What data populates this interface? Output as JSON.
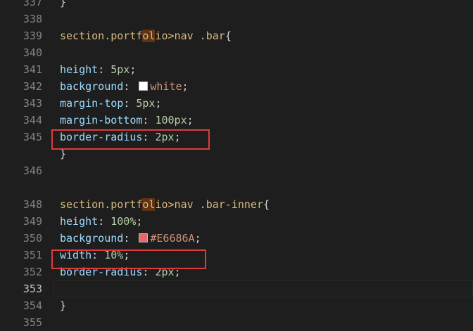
{
  "colors": {
    "swatch_white": "#ffffff",
    "swatch_bar_inner": "#E6686A",
    "highlight_box": "#e03b3b"
  },
  "lines": [
    {
      "num": "337",
      "parts": [
        {
          "t": "}",
          "c": "punc"
        }
      ]
    },
    {
      "num": "338",
      "parts": []
    },
    {
      "num": "339",
      "parts": [
        {
          "t": "section.portf",
          "c": "sel"
        },
        {
          "t": "ol",
          "c": "sel hl"
        },
        {
          "t": "io>nav .bar",
          "c": "sel"
        },
        {
          "t": "{",
          "c": "punc"
        }
      ]
    },
    {
      "num": "340",
      "parts": []
    },
    {
      "num": "341",
      "parts": [
        {
          "t": "height",
          "c": "prop"
        },
        {
          "t": ": ",
          "c": "punc"
        },
        {
          "t": "5px",
          "c": "val"
        },
        {
          "t": ";",
          "c": "punc"
        }
      ]
    },
    {
      "num": "342",
      "parts": [
        {
          "t": "background",
          "c": "prop"
        },
        {
          "t": ": ",
          "c": "punc"
        },
        {
          "swatch": "swatch_white"
        },
        {
          "t": "white",
          "c": "str"
        },
        {
          "t": ";",
          "c": "punc"
        }
      ]
    },
    {
      "num": "343",
      "parts": [
        {
          "t": "margin-top",
          "c": "prop"
        },
        {
          "t": ": ",
          "c": "punc"
        },
        {
          "t": "5px",
          "c": "val"
        },
        {
          "t": ";",
          "c": "punc"
        }
      ]
    },
    {
      "num": "344",
      "parts": [
        {
          "t": "margin-bottom",
          "c": "prop"
        },
        {
          "t": ": ",
          "c": "punc"
        },
        {
          "t": "100px",
          "c": "val"
        },
        {
          "t": ";",
          "c": "punc"
        }
      ]
    },
    {
      "num": "345",
      "parts": [
        {
          "t": "border-radius",
          "c": "prop"
        },
        {
          "t": ": ",
          "c": "punc"
        },
        {
          "t": "2px",
          "c": "val"
        },
        {
          "t": ";",
          "c": "punc"
        }
      ]
    },
    {
      "num": "",
      "parts": [
        {
          "t": "}",
          "c": "punc"
        }
      ]
    },
    {
      "num": "346",
      "parts": []
    },
    {
      "num": "",
      "parts": []
    },
    {
      "num": "348",
      "parts": [
        {
          "t": "section.portf",
          "c": "sel"
        },
        {
          "t": "ol",
          "c": "sel hl"
        },
        {
          "t": "io>nav .bar-inner",
          "c": "sel"
        },
        {
          "t": "{",
          "c": "punc"
        }
      ]
    },
    {
      "num": "349",
      "parts": [
        {
          "t": "height",
          "c": "prop"
        },
        {
          "t": ": ",
          "c": "punc"
        },
        {
          "t": "100%",
          "c": "val"
        },
        {
          "t": ";",
          "c": "punc"
        }
      ]
    },
    {
      "num": "350",
      "parts": [
        {
          "t": "background",
          "c": "prop"
        },
        {
          "t": ": ",
          "c": "punc"
        },
        {
          "swatch": "swatch_bar_inner"
        },
        {
          "t": "#E6686A",
          "c": "str"
        },
        {
          "t": ";",
          "c": "punc"
        }
      ]
    },
    {
      "num": "351",
      "parts": [
        {
          "t": "width",
          "c": "prop"
        },
        {
          "t": ": ",
          "c": "punc"
        },
        {
          "t": "10%",
          "c": "val"
        },
        {
          "t": ";",
          "c": "punc"
        }
      ]
    },
    {
      "num": "352",
      "parts": [
        {
          "t": "border-radius",
          "c": "prop"
        },
        {
          "t": ": ",
          "c": "punc"
        },
        {
          "t": "2px",
          "c": "val"
        },
        {
          "t": ";",
          "c": "punc"
        }
      ]
    },
    {
      "num": "353",
      "parts": [],
      "active": true
    },
    {
      "num": "354",
      "parts": [
        {
          "t": "}",
          "c": "punc"
        }
      ]
    },
    {
      "num": "355",
      "parts": []
    }
  ]
}
